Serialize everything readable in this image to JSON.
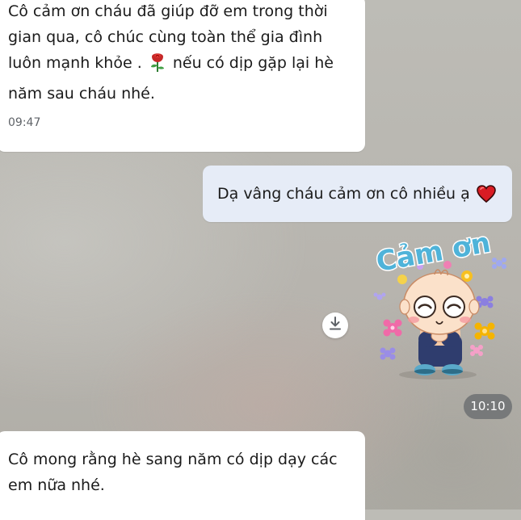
{
  "messages": [
    {
      "direction": "incoming",
      "text_part1": "Cô cảm ơn cháu đã giúp đỡ em trong thời gian qua, cô chúc  cùng toàn thể gia đình luôn mạnh khỏe .",
      "emoji": "rose-icon",
      "text_part2": "nếu có dịp gặp lại hè năm sau cháu nhé.",
      "time": "09:47"
    },
    {
      "direction": "outgoing",
      "text": "Dạ vâng cháu cảm ơn cô nhiều ạ",
      "emoji": "red-heart-icon"
    },
    {
      "direction": "outgoing",
      "type": "sticker",
      "sticker_text": "Cảm ơn",
      "time": "10:10",
      "download_icon": "download-icon"
    },
    {
      "direction": "incoming",
      "text": "Cô mong rằng hè sang năm có dịp dạy các em nữa nhé."
    }
  ],
  "colors": {
    "incoming_bubble": "#ffffff",
    "outgoing_bubble": "#e6ecf7",
    "time_pill": "#77797a",
    "sticker_text": "#4fb3d9"
  }
}
